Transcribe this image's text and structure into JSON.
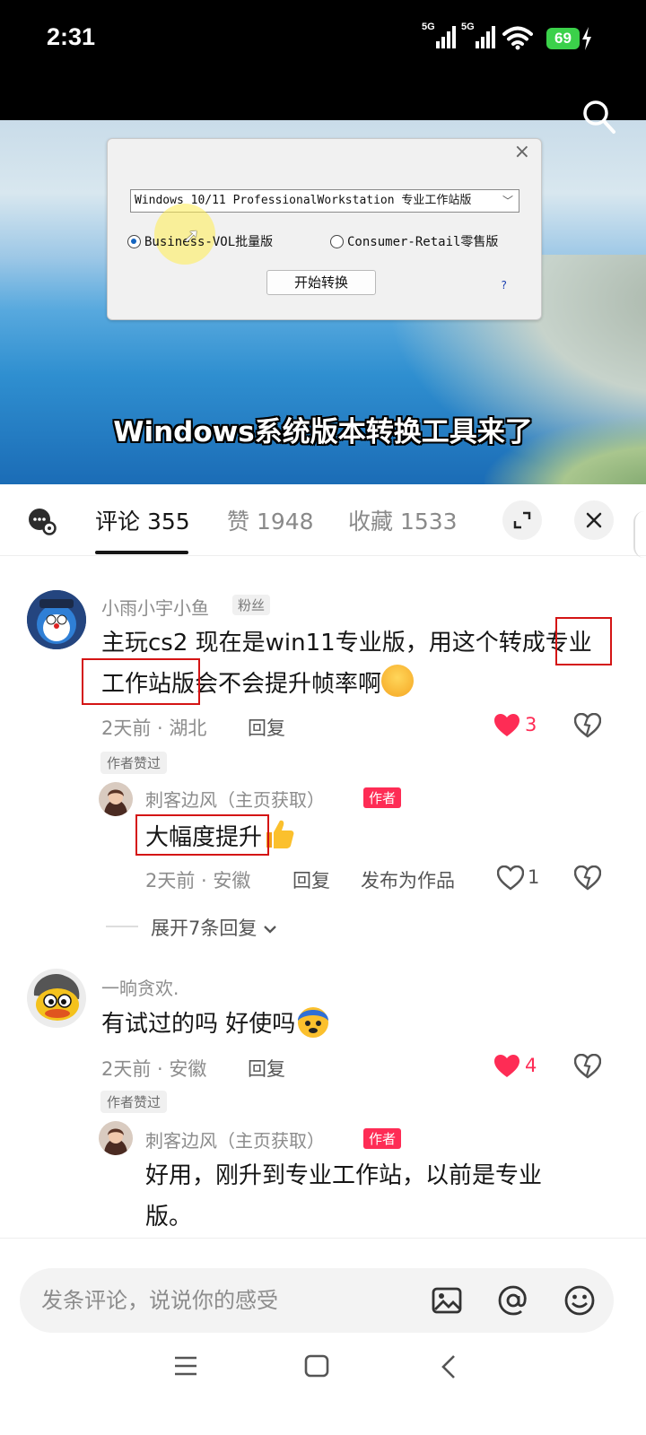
{
  "status_bar": {
    "time": "2:31",
    "net1": "5G",
    "net2": "5G",
    "battery": "69"
  },
  "video": {
    "dialog": {
      "edition": "Windows 10/11 ProfessionalWorkstation 专业工作站版",
      "radio_business": "Business-VOL批量版",
      "radio_consumer": "Consumer-Retail零售版",
      "convert_button": "开始转换",
      "help": "?"
    },
    "caption": "Windows系统版本转换工具来了"
  },
  "tabs": {
    "comments": "评论 355",
    "likes": "赞 1948",
    "favorites": "收藏 1533"
  },
  "comments": [
    {
      "user": "小雨小宇小鱼",
      "badge": "粉丝",
      "text_line1": "主玩cs2 现在是win11专业版，用这个转成专业",
      "text_line2": "工作站版会不会提升帧率啊",
      "time_loc": "2天前 · 湖北",
      "reply": "回复",
      "likes": "3",
      "author_liked": "作者赞过",
      "replies": [
        {
          "user": "刺客边风（主页获取）",
          "role": "作者",
          "text": "大幅度提升",
          "time_loc": "2天前 · 安徽",
          "reply": "回复",
          "publish": "发布为作品",
          "likes": "1"
        }
      ],
      "expand": "展开7条回复"
    },
    {
      "user": "一晌贪欢.",
      "text": "有试过的吗 好使吗",
      "time_loc": "2天前 · 安徽",
      "reply": "回复",
      "likes": "4",
      "author_liked": "作者赞过",
      "replies": [
        {
          "user": "刺客边风（主页获取）",
          "role": "作者",
          "text_line1": "好用，刚升到专业工作站，以前是专业",
          "text_line2": "版。"
        }
      ]
    }
  ],
  "input": {
    "placeholder": "发条评论，说说你的感受"
  },
  "colors": {
    "accent_red": "#fe2c55",
    "highlight_box": "#d41414",
    "battery_green": "#3bd14a"
  }
}
